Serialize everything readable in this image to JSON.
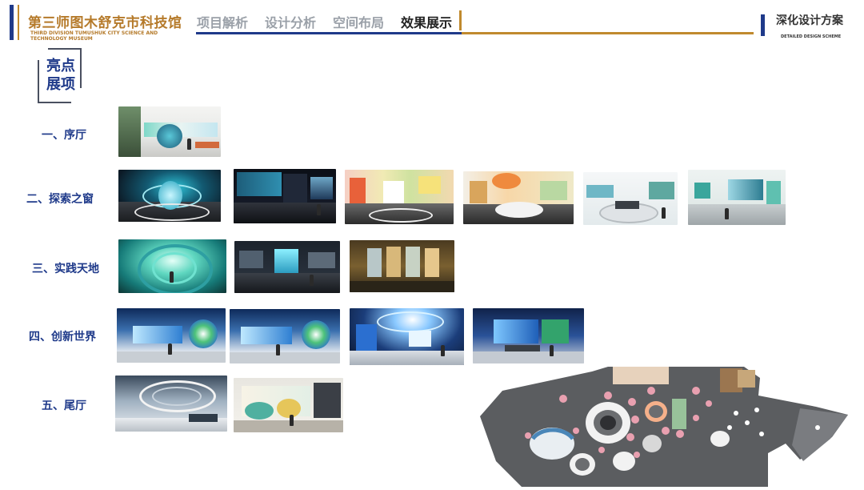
{
  "header": {
    "museum_name_cn": "第三师图木舒克市科技馆",
    "museum_name_en_line1": "THIRD DIVISION TUMUSHUK CITY SCIENCE AND",
    "museum_name_en_line2": "TECHNOLOGY MUSEUM",
    "nav": [
      {
        "label": "项目解析",
        "active": false
      },
      {
        "label": "设计分析",
        "active": false
      },
      {
        "label": "空间布局",
        "active": false
      },
      {
        "label": "效果展示",
        "active": true
      }
    ],
    "scheme_title": "深化设计方案",
    "scheme_subtitle": "DETAILED DESIGN SCHEME"
  },
  "highlight_tag": {
    "line1": "亮点",
    "line2": "展项"
  },
  "sections": [
    {
      "label": "一、序厅",
      "image_count": 1
    },
    {
      "label": "二、探索之窗",
      "image_count": 6
    },
    {
      "label": "三、实践天地",
      "image_count": 3
    },
    {
      "label": "四、创新世界",
      "image_count": 4
    },
    {
      "label": "五、尾厅",
      "image_count": 2
    }
  ],
  "colors": {
    "brand_blue": "#1f3a8a",
    "brand_gold": "#c08a2e",
    "nav_inactive": "#9aa0a8"
  }
}
